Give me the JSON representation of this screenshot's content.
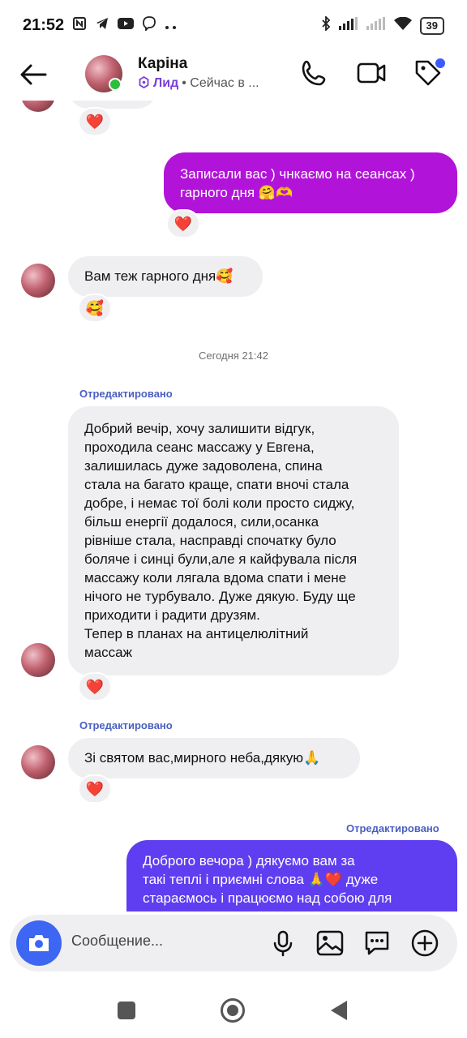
{
  "status_bar": {
    "time": "21:52",
    "battery": "39",
    "left_icons": [
      "nfc-icon",
      "telegram-icon",
      "youtube-icon",
      "viber-icon",
      "more-dots-icon"
    ],
    "right_icons": [
      "bluetooth-icon",
      "signal-icon",
      "signal-icon",
      "wifi-icon",
      "battery-icon"
    ]
  },
  "header": {
    "contact_name": "Каріна",
    "tag": "Лид",
    "status": "• Сейчас в ..."
  },
  "messages": [
    {
      "id": "m1",
      "from": "incoming-partial",
      "reaction": "❤️"
    },
    {
      "id": "m2",
      "from": "outgoing",
      "text": "Записали вас ) чнкаємо на сеансах )\nгарного дня 🤗🫶",
      "reaction": "❤️"
    },
    {
      "id": "m3",
      "from": "incoming",
      "text": "Вам теж гарного дня🥰",
      "reaction": "🥰"
    },
    {
      "id": "m4",
      "from": "incoming",
      "edited": "Отредактировано",
      "text": "Добрий вечір, хочу залишити відгук,\nпроходила сеанс массажу  у  Евгена,\nзалишилась дуже задоволена, спина\nстала на багато краще,  спати вночі стала\nдобре, і немає тої болі коли просто сиджу,\nбільш енергії додалося, сили,осанка\nрівніше стала, насправді спочатку було\nболяче і синці були,але я кайфувала після\nмассажу коли лягала вдома спати і мене\nнічого не турбувало. Дуже дякую. Буду ще\nприходити і радити друзям.\nТепер в планах на антицелюлітний\nмассаж",
      "reaction": "❤️"
    },
    {
      "id": "m5",
      "from": "incoming",
      "edited": "Отредактировано",
      "text": "Зі святом вас,мирного неба,дякую🙏",
      "reaction": "❤️"
    },
    {
      "id": "m6",
      "from": "outgoing",
      "edited": "Отредактировано",
      "text": "Доброго вечора ) дякуємо вам за\nтакі теплі і приємні слова 🙏❤️ дуже\nстараємось і працюємо над собою для"
    }
  ],
  "timestamp": "Сегодня 21:42",
  "composer": {
    "placeholder": "Сообщение..."
  },
  "colors": {
    "outgoing_purple": "#b213d8",
    "outgoing_blue": "#5e3ef0",
    "incoming_bg": "#efeff1",
    "accent_blue": "#3d66f3",
    "lead_purple": "#7a3fd9",
    "edited_blue": "#4a5fc1",
    "online_green": "#2dbe3c"
  }
}
